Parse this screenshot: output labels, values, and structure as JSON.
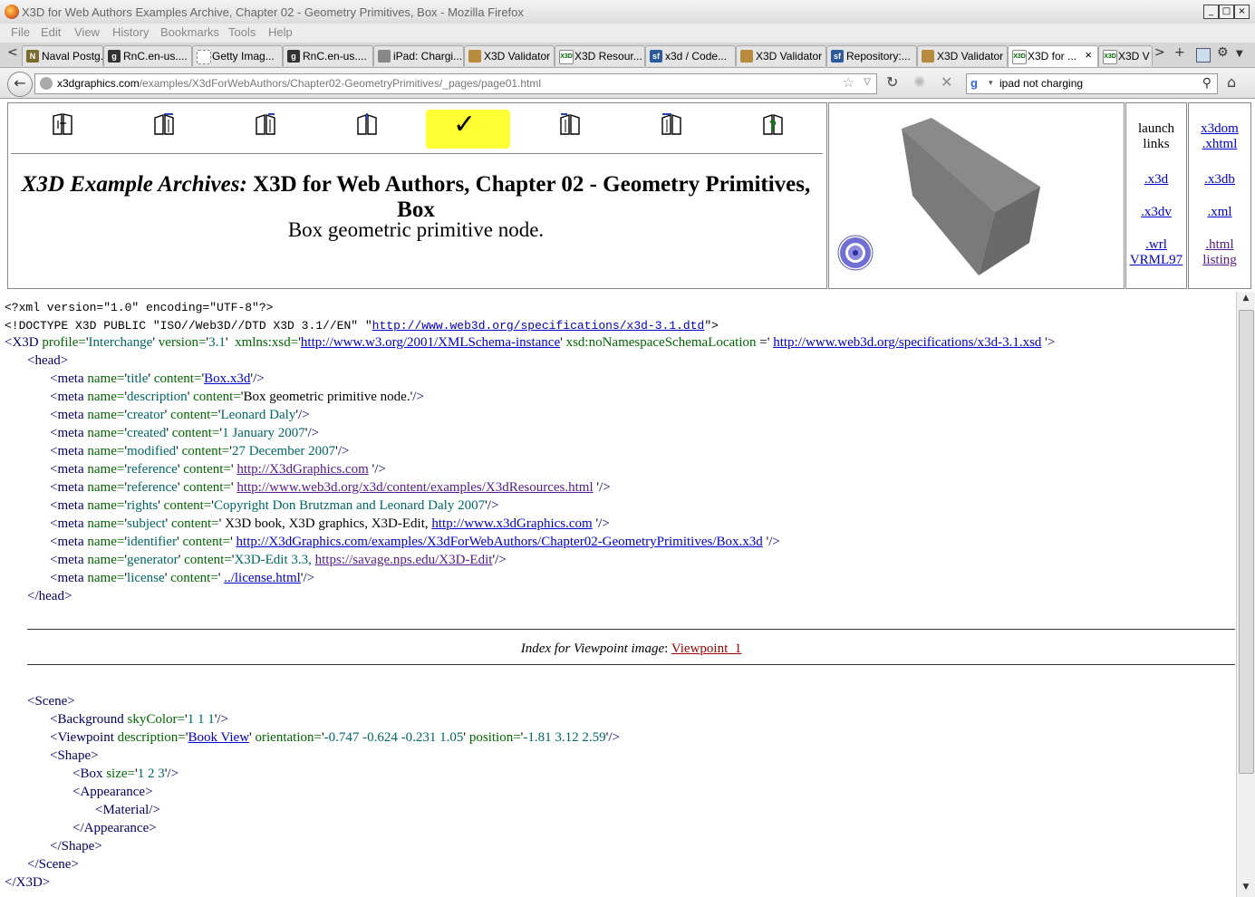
{
  "window": {
    "title": "X3D for Web Authors Examples Archive, Chapter 02 - Geometry Primitives, Box - Mozilla Firefox",
    "minimize": "_",
    "maximize": "□",
    "close": "×"
  },
  "menu": {
    "items": [
      {
        "label": "File"
      },
      {
        "label": "Edit"
      },
      {
        "label": "View"
      },
      {
        "label": "History"
      },
      {
        "label": "Bookmarks"
      },
      {
        "label": "Tools"
      },
      {
        "label": "Help"
      }
    ]
  },
  "tabs": {
    "scroll_left": "<",
    "scroll_right": ">",
    "new_tab": "+",
    "items": [
      {
        "label": "Naval Postg...",
        "icon": "nps-icon"
      },
      {
        "label": "RnC.en-us....",
        "icon": "g-icon"
      },
      {
        "label": "Getty Imag...",
        "icon": "getty-icon"
      },
      {
        "label": "RnC.en-us....",
        "icon": "g-icon"
      },
      {
        "label": "iPad: Chargi...",
        "icon": "apple-icon"
      },
      {
        "label": "X3D Validator",
        "icon": "validator-icon"
      },
      {
        "label": "X3D Resour...",
        "icon": "x3d-icon"
      },
      {
        "label": "x3d / Code...",
        "icon": "sf-icon"
      },
      {
        "label": "X3D Validator",
        "icon": "validator-icon"
      },
      {
        "label": "Repository:...",
        "icon": "sf-icon"
      },
      {
        "label": "X3D Validator",
        "icon": "validator-icon"
      },
      {
        "label": "X3D for ...",
        "icon": "x3d-icon",
        "active": true
      },
      {
        "label": "X3D V",
        "icon": "x3d-icon"
      }
    ]
  },
  "nav": {
    "url_domain": "x3dgraphics.com",
    "url_path": "/examples/X3dForWebAuthors/Chapter02-GeometryPrimitives/_pages/page01.html",
    "search_query": "ipad not charging"
  },
  "header": {
    "title_italic": "X3D Example Archives:",
    "title_rest": " X3D for Web Authors, Chapter 02 - Geometry Primitives, Box",
    "description": "Box geometric primitive node.",
    "check": "✓",
    "launch_label_1": "launch",
    "launch_label_2": "links",
    "links": {
      "x3dom_1": "x3dom",
      "x3dom_2": ".xhtml",
      "x3d": ".x3d",
      "x3db": ".x3db",
      "x3dv": ".x3dv",
      "xml": ".xml",
      "wrl_1": ".wrl",
      "wrl_2": "VRML97",
      "html_1": ".html",
      "html_2": "listing"
    }
  },
  "code": {
    "xml_decl": "<?xml version=\"1.0\" encoding=\"UTF-8\"?>",
    "doctype_pre": "<!DOCTYPE X3D PUBLIC \"ISO//Web3D//DTD X3D 3.1//EN\" \"",
    "doctype_link": "http://www.web3d.org/specifications/x3d-3.1.dtd",
    "doctype_post": "\">",
    "x3d_profile": "Interchange",
    "x3d_version": "3.1",
    "xsd_link": "http://www.w3.org/2001/XMLSchema-instance",
    "schema_link": "http://www.web3d.org/specifications/x3d-3.1.xsd",
    "meta": [
      {
        "name": "title",
        "content_link": "Box.x3d"
      },
      {
        "name": "description",
        "content": "Box geometric primitive node."
      },
      {
        "name": "creator",
        "content": "Leonard Daly"
      },
      {
        "name": "created",
        "content": "1 January 2007"
      },
      {
        "name": "modified",
        "content": "27 December 2007"
      },
      {
        "name": "reference",
        "content_link": "http://X3dGraphics.com"
      },
      {
        "name": "reference",
        "content_link": "http://www.web3d.org/x3d/content/examples/X3dResources.html"
      },
      {
        "name": "rights",
        "content": "Copyright Don Brutzman and Leonard Daly 2007"
      },
      {
        "name": "subject",
        "content": "X3D book, X3D graphics, X3D-Edit, ",
        "content_link": "http://www.x3dGraphics.com"
      },
      {
        "name": "identifier",
        "content_link": "http://X3dGraphics.com/examples/X3dForWebAuthors/Chapter02-GeometryPrimitives/Box.x3d"
      },
      {
        "name": "generator",
        "content": "X3D-Edit 3.3, ",
        "content_link": "https://savage.nps.edu/X3D-Edit"
      },
      {
        "name": "license",
        "content_link": "../license.html"
      }
    ],
    "viewpoint_index_label": "Index for Viewpoint image",
    "viewpoint_index_link": "Viewpoint_1",
    "background_skycolor": "1 1 1",
    "viewpoint_description": "Book View",
    "viewpoint_orientation": "-0.747 -0.624 -0.231 1.05",
    "viewpoint_position": "-1.81 3.12 2.59",
    "box_size": "1 2 3"
  }
}
